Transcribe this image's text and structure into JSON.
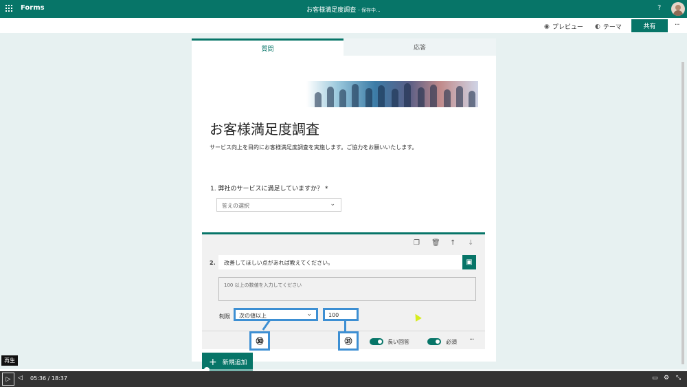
{
  "appbar": {
    "app_name": "Forms",
    "form_title": "お客様満足度調査",
    "save_status": "- 保存中...",
    "help": "?"
  },
  "commandbar": {
    "preview_label": "プレビュー",
    "theme_label": "テーマ",
    "share_label": "共有",
    "more": "···"
  },
  "tabs": {
    "questions": "質問",
    "responses": "応答"
  },
  "survey": {
    "title": "お客様満足度調査",
    "description": "サービス向上を目的にお客様満足度調査を実施します。ご協力をお願いいたします。"
  },
  "question1": {
    "label": "1. 弊社のサービスに満足していますか？ *",
    "placeholder": "答えの選択"
  },
  "question2": {
    "number": "2.",
    "text": "改善してほしい点があれば教えてください。",
    "answer_placeholder": "100 以上の数値を入力してください",
    "limit_label": "制限",
    "limit_condition": "次の値以上",
    "limit_value": "100",
    "long_answer_label": "長い回答",
    "required_label": "必須",
    "more": "···"
  },
  "callouts": {
    "first": "㉚",
    "second": "㉛"
  },
  "add_new_label": "新規追加",
  "player": {
    "tooltip": "再生",
    "current_time": "05:36",
    "separator": "/",
    "duration": "18:37",
    "progress": 0.301
  },
  "colors": {
    "accent": "#077568",
    "callout": "#3d8fd3",
    "player_bg": "#333333"
  }
}
